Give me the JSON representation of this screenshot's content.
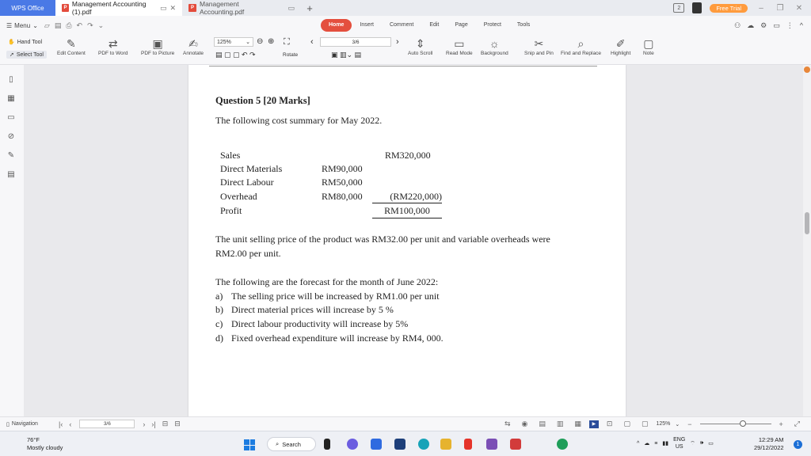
{
  "titlebar": {
    "app_tab": "WPS Office",
    "tabs": [
      {
        "label": "Management Accounting (1).pdf",
        "active": true
      },
      {
        "label": "Management Accounting.pdf",
        "active": false
      }
    ],
    "new_tab": "+",
    "free_trial": "Free Trial",
    "badge_count": "2"
  },
  "menu": {
    "menu_label": "Menu",
    "ribbon_tabs": [
      "Home",
      "Insert",
      "Comment",
      "Edit",
      "Page",
      "Protect",
      "Tools"
    ],
    "active_tab": "Home"
  },
  "toolbar": {
    "hand_tool": "Hand Tool",
    "select_tool": "Select Tool",
    "edit_content": "Edit Content",
    "pdf_to_word": "PDF to Word",
    "pdf_to_picture": "PDF to Picture",
    "annotate": "Annotate",
    "zoom": "125%",
    "rotate": "Rotate",
    "page_indicator": "3/6",
    "auto_scroll": "Auto Scroll",
    "read_mode": "Read Mode",
    "background": "Background",
    "snip_and_pin": "Snip and Pin",
    "find_and_replace": "Find and Replace",
    "highlight": "Highlight",
    "note": "Note"
  },
  "document": {
    "question_title": "Question 5 [20 Marks]",
    "intro": "The following cost summary for May 2022.",
    "summary_rows": [
      {
        "label": "Sales",
        "col1": "",
        "col2": "RM320,000"
      },
      {
        "label": "Direct Materials",
        "col1": "RM90,000",
        "col2": ""
      },
      {
        "label": "Direct Labour",
        "col1": "RM50,000",
        "col2": ""
      },
      {
        "label": "Overhead",
        "col1": "RM80,000",
        "col2": "(RM220,000)"
      },
      {
        "label": "Profit",
        "col1": "",
        "col2": "RM100,000"
      }
    ],
    "para1_line1": "The unit selling price of the product was RM32.00 per unit and variable overheads were",
    "para1_line2": "RM2.00 per unit.",
    "forecast_intro": "The following are the forecast for the month of June 2022:",
    "forecast_items": [
      {
        "marker": "a)",
        "text": "The selling price will be increased by RM1.00 per unit"
      },
      {
        "marker": "b)",
        "text": "Direct material prices will increase by 5 %"
      },
      {
        "marker": "c)",
        "text": "Direct labour productivity will increase by 5%"
      },
      {
        "marker": "d)",
        "text": "Fixed overhead expenditure will increase by RM4, 000."
      }
    ]
  },
  "statusbar": {
    "navigation": "Navigation",
    "page": "3/6",
    "zoom": "125%",
    "zoom_fraction": 0.6
  },
  "taskbar": {
    "temperature": "76°F",
    "weather": "Mostly cloudy",
    "search": "Search",
    "lang": "ENG",
    "region": "US",
    "time": "12:29 AM",
    "date": "29/12/2022",
    "notifications": "1"
  }
}
